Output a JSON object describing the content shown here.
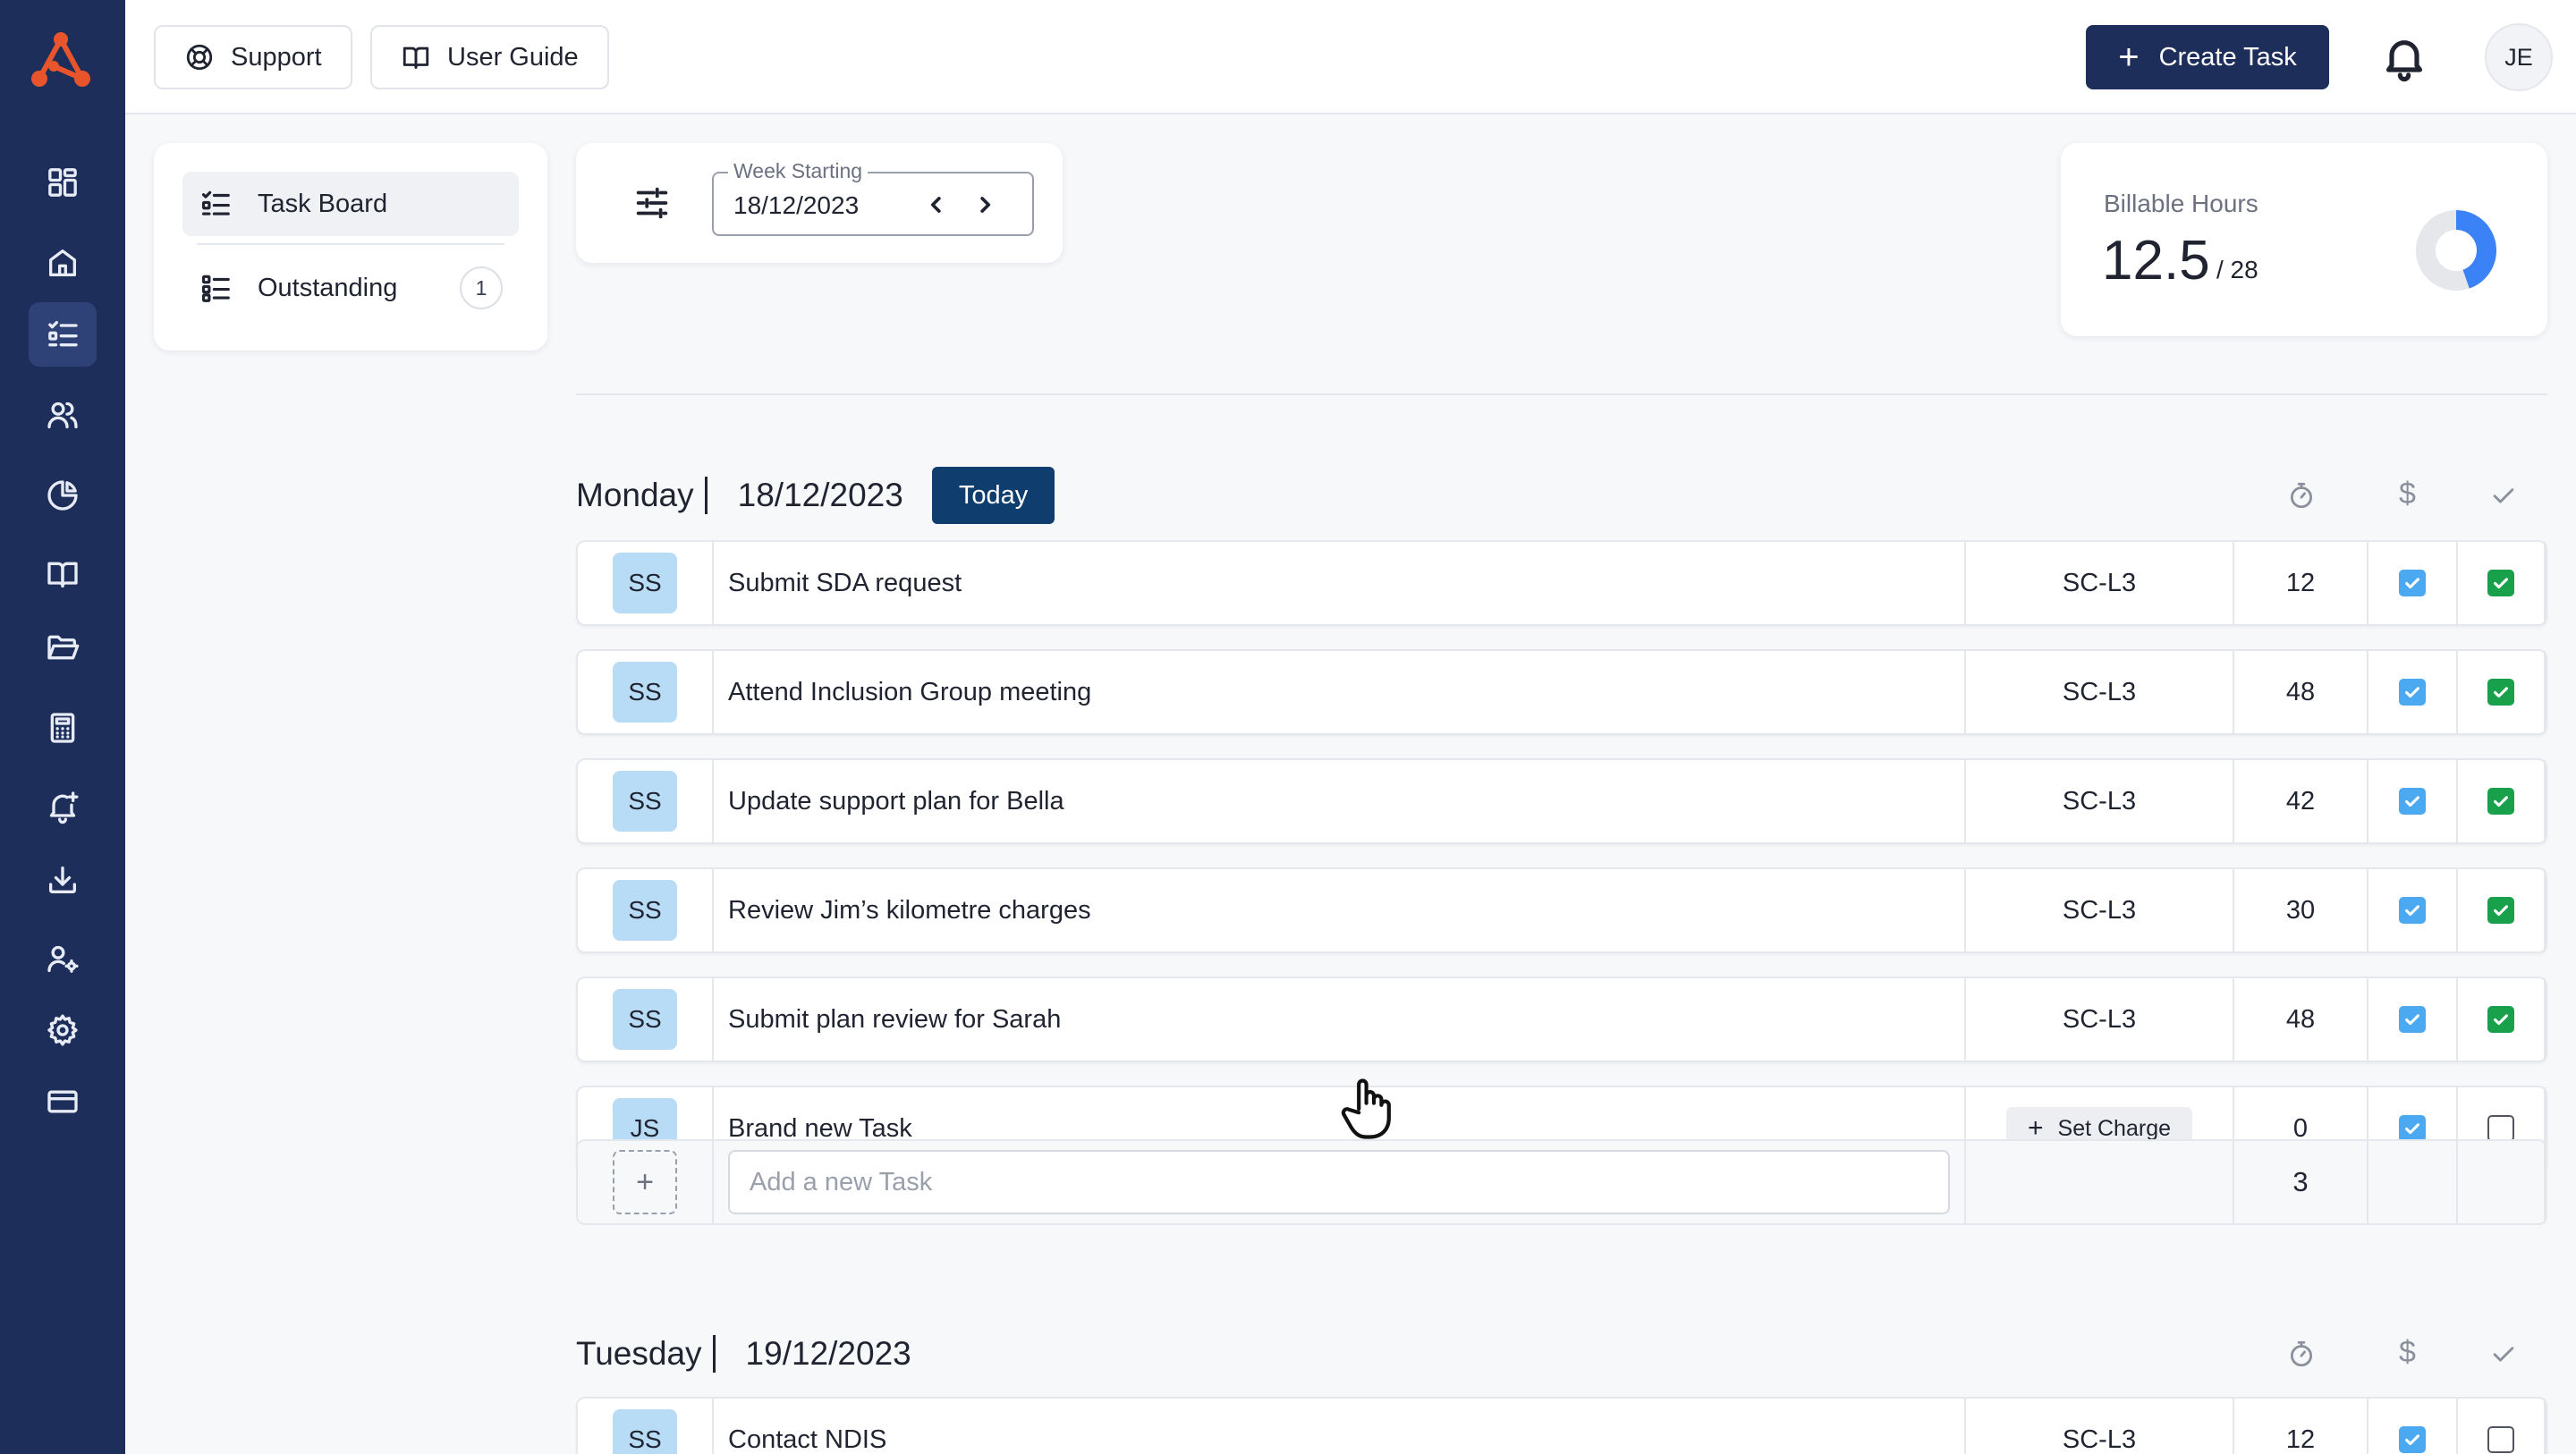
{
  "topbar": {
    "support_label": "Support",
    "user_guide_label": "User Guide",
    "create_task_label": "Create Task",
    "avatar_initials": "JE"
  },
  "sidebar": {
    "items": [
      {
        "icon": "dashboard-icon"
      },
      {
        "icon": "home-icon"
      },
      {
        "icon": "task-list-icon",
        "active": true
      },
      {
        "icon": "users-icon"
      },
      {
        "icon": "pie-chart-icon"
      },
      {
        "icon": "book-icon"
      },
      {
        "icon": "folder-icon"
      },
      {
        "icon": "calculator-icon"
      },
      {
        "icon": "bell-plus-icon"
      },
      {
        "icon": "download-icon"
      },
      {
        "icon": "user-settings-icon"
      },
      {
        "icon": "gear-icon"
      },
      {
        "icon": "credit-card-icon"
      }
    ]
  },
  "left_panel": {
    "task_board_label": "Task Board",
    "outstanding_label": "Outstanding",
    "outstanding_count": "1"
  },
  "week": {
    "legend": "Week Starting",
    "value": "18/12/2023"
  },
  "billable": {
    "label": "Billable Hours",
    "value": "12.5",
    "total": "/ 28",
    "fraction": 0.446
  },
  "monday": {
    "day": "Monday",
    "date": "18/12/2023",
    "today_label": "Today",
    "tasks": [
      {
        "initials": "SS",
        "title": "Submit SDA request",
        "code": "SC-L3",
        "minutes": "12",
        "billable": true,
        "done": true
      },
      {
        "initials": "SS",
        "title": "Attend Inclusion Group meeting",
        "code": "SC-L3",
        "minutes": "48",
        "billable": true,
        "done": true
      },
      {
        "initials": "SS",
        "title": "Update support plan for Bella",
        "code": "SC-L3",
        "minutes": "42",
        "billable": true,
        "done": true
      },
      {
        "initials": "SS",
        "title": "Review Jim’s kilometre charges",
        "code": "SC-L3",
        "minutes": "30",
        "billable": true,
        "done": true
      },
      {
        "initials": "SS",
        "title": "Submit plan review for Sarah",
        "code": "SC-L3",
        "minutes": "48",
        "billable": true,
        "done": true
      },
      {
        "initials": "JS",
        "title": "Brand new Task",
        "set_charge_label": "Set Charge",
        "minutes": "0",
        "billable": true,
        "done": false
      }
    ],
    "add_placeholder": "Add a new Task",
    "task_count": "3"
  },
  "tuesday": {
    "day": "Tuesday",
    "date": "19/12/2023",
    "tasks": [
      {
        "initials": "SS",
        "title": "Contact NDIS",
        "code": "SC-L3",
        "minutes": "12",
        "billable": true,
        "done": false
      }
    ]
  },
  "colors": {
    "sidebar": "#1e2e5a",
    "primary": "#1e2e5a",
    "today_badge": "#0f3d6e",
    "billable_check": "#4aa9f0",
    "done_check": "#18a14a",
    "avatar_bg": "#b9dcf6",
    "donut_fill": "#3b82f6"
  }
}
